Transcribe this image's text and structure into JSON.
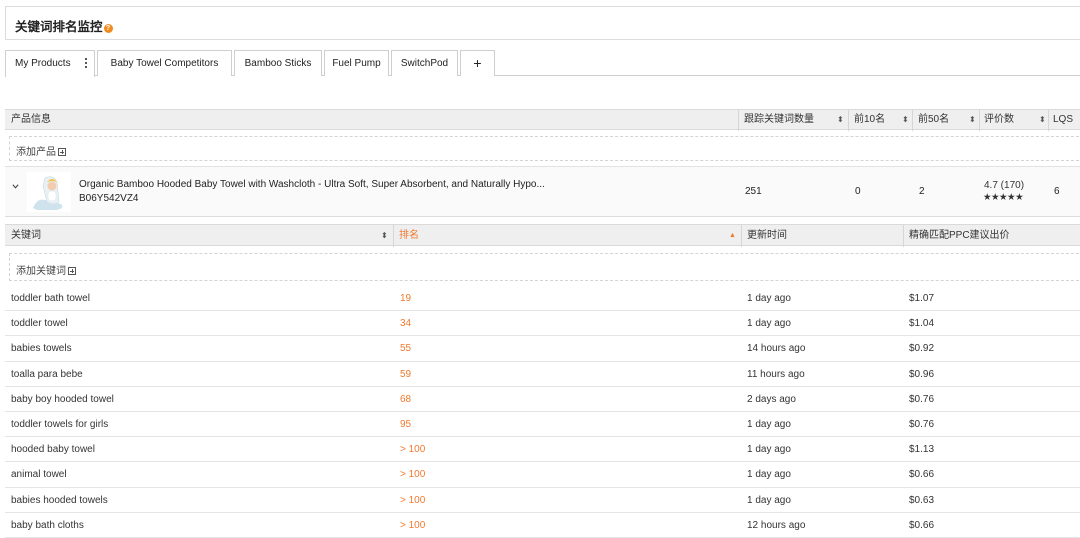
{
  "header": {
    "title": "关键词排名监控"
  },
  "tabs": [
    {
      "label": "My Products",
      "active": true
    },
    {
      "label": "Baby Towel Competitors"
    },
    {
      "label": "Bamboo Sticks"
    },
    {
      "label": "Fuel Pump"
    },
    {
      "label": "SwitchPod"
    },
    {
      "label": "+"
    }
  ],
  "product_table": {
    "columns": {
      "product_info": "产品信息",
      "tracked_keywords": "跟踪关键词数量",
      "top10": "前10名",
      "top50": "前50名",
      "reviews": "评价数",
      "lqs": "LQS"
    },
    "add_product_label": "添加产品",
    "product": {
      "title": "Organic Bamboo Hooded Baby Towel with Washcloth - Ultra Soft, Super Absorbent, and Naturally Hypo...",
      "asin": "B06Y542VZ4",
      "tracked_keywords": "251",
      "top10": "0",
      "top50": "2",
      "rating": "4.7 (170)",
      "rating_value": 4.7,
      "stars": "★★★★★",
      "lqs": "6"
    }
  },
  "keyword_table": {
    "columns": {
      "keyword": "关键词",
      "rank": "排名",
      "updated": "更新时间",
      "ppc": "精确匹配PPC建议出价"
    },
    "add_keyword_label": "添加关键词",
    "rows": [
      {
        "keyword": "toddler bath towel",
        "rank": "19",
        "updated": "1 day ago",
        "ppc": "$1.07"
      },
      {
        "keyword": "toddler towel",
        "rank": "34",
        "updated": "1 day ago",
        "ppc": "$1.04"
      },
      {
        "keyword": "babies towels",
        "rank": "55",
        "updated": "14 hours ago",
        "ppc": "$0.92"
      },
      {
        "keyword": "toalla para bebe",
        "rank": "59",
        "updated": "11 hours ago",
        "ppc": "$0.96"
      },
      {
        "keyword": "baby boy hooded towel",
        "rank": "68",
        "updated": "2 days ago",
        "ppc": "$0.76"
      },
      {
        "keyword": "toddler towels for girls",
        "rank": "95",
        "updated": "1 day ago",
        "ppc": "$0.76"
      },
      {
        "keyword": "hooded baby towel",
        "rank": "> 100",
        "updated": "1 day ago",
        "ppc": "$1.13"
      },
      {
        "keyword": "animal towel",
        "rank": "> 100",
        "updated": "1 day ago",
        "ppc": "$0.66"
      },
      {
        "keyword": "babies hooded towels",
        "rank": "> 100",
        "updated": "1 day ago",
        "ppc": "$0.63"
      },
      {
        "keyword": "baby bath cloths",
        "rank": "> 100",
        "updated": "12 hours ago",
        "ppc": "$0.66"
      }
    ]
  },
  "colors": {
    "accent": "#f07a2e",
    "help_icon": "#f08c1e",
    "header_bg": "#efefef"
  }
}
